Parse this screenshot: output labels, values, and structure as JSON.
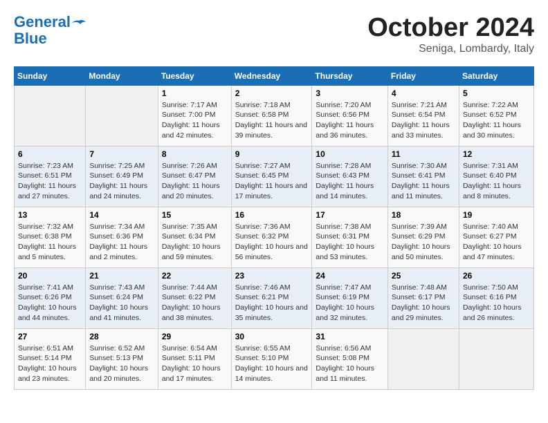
{
  "header": {
    "logo_line1": "General",
    "logo_line2": "Blue",
    "month": "October 2024",
    "location": "Seniga, Lombardy, Italy"
  },
  "days_of_week": [
    "Sunday",
    "Monday",
    "Tuesday",
    "Wednesday",
    "Thursday",
    "Friday",
    "Saturday"
  ],
  "weeks": [
    [
      {
        "day": "",
        "info": ""
      },
      {
        "day": "",
        "info": ""
      },
      {
        "day": "1",
        "info": "Sunrise: 7:17 AM\nSunset: 7:00 PM\nDaylight: 11 hours and 42 minutes."
      },
      {
        "day": "2",
        "info": "Sunrise: 7:18 AM\nSunset: 6:58 PM\nDaylight: 11 hours and 39 minutes."
      },
      {
        "day": "3",
        "info": "Sunrise: 7:20 AM\nSunset: 6:56 PM\nDaylight: 11 hours and 36 minutes."
      },
      {
        "day": "4",
        "info": "Sunrise: 7:21 AM\nSunset: 6:54 PM\nDaylight: 11 hours and 33 minutes."
      },
      {
        "day": "5",
        "info": "Sunrise: 7:22 AM\nSunset: 6:52 PM\nDaylight: 11 hours and 30 minutes."
      }
    ],
    [
      {
        "day": "6",
        "info": "Sunrise: 7:23 AM\nSunset: 6:51 PM\nDaylight: 11 hours and 27 minutes."
      },
      {
        "day": "7",
        "info": "Sunrise: 7:25 AM\nSunset: 6:49 PM\nDaylight: 11 hours and 24 minutes."
      },
      {
        "day": "8",
        "info": "Sunrise: 7:26 AM\nSunset: 6:47 PM\nDaylight: 11 hours and 20 minutes."
      },
      {
        "day": "9",
        "info": "Sunrise: 7:27 AM\nSunset: 6:45 PM\nDaylight: 11 hours and 17 minutes."
      },
      {
        "day": "10",
        "info": "Sunrise: 7:28 AM\nSunset: 6:43 PM\nDaylight: 11 hours and 14 minutes."
      },
      {
        "day": "11",
        "info": "Sunrise: 7:30 AM\nSunset: 6:41 PM\nDaylight: 11 hours and 11 minutes."
      },
      {
        "day": "12",
        "info": "Sunrise: 7:31 AM\nSunset: 6:40 PM\nDaylight: 11 hours and 8 minutes."
      }
    ],
    [
      {
        "day": "13",
        "info": "Sunrise: 7:32 AM\nSunset: 6:38 PM\nDaylight: 11 hours and 5 minutes."
      },
      {
        "day": "14",
        "info": "Sunrise: 7:34 AM\nSunset: 6:36 PM\nDaylight: 11 hours and 2 minutes."
      },
      {
        "day": "15",
        "info": "Sunrise: 7:35 AM\nSunset: 6:34 PM\nDaylight: 10 hours and 59 minutes."
      },
      {
        "day": "16",
        "info": "Sunrise: 7:36 AM\nSunset: 6:32 PM\nDaylight: 10 hours and 56 minutes."
      },
      {
        "day": "17",
        "info": "Sunrise: 7:38 AM\nSunset: 6:31 PM\nDaylight: 10 hours and 53 minutes."
      },
      {
        "day": "18",
        "info": "Sunrise: 7:39 AM\nSunset: 6:29 PM\nDaylight: 10 hours and 50 minutes."
      },
      {
        "day": "19",
        "info": "Sunrise: 7:40 AM\nSunset: 6:27 PM\nDaylight: 10 hours and 47 minutes."
      }
    ],
    [
      {
        "day": "20",
        "info": "Sunrise: 7:41 AM\nSunset: 6:26 PM\nDaylight: 10 hours and 44 minutes."
      },
      {
        "day": "21",
        "info": "Sunrise: 7:43 AM\nSunset: 6:24 PM\nDaylight: 10 hours and 41 minutes."
      },
      {
        "day": "22",
        "info": "Sunrise: 7:44 AM\nSunset: 6:22 PM\nDaylight: 10 hours and 38 minutes."
      },
      {
        "day": "23",
        "info": "Sunrise: 7:46 AM\nSunset: 6:21 PM\nDaylight: 10 hours and 35 minutes."
      },
      {
        "day": "24",
        "info": "Sunrise: 7:47 AM\nSunset: 6:19 PM\nDaylight: 10 hours and 32 minutes."
      },
      {
        "day": "25",
        "info": "Sunrise: 7:48 AM\nSunset: 6:17 PM\nDaylight: 10 hours and 29 minutes."
      },
      {
        "day": "26",
        "info": "Sunrise: 7:50 AM\nSunset: 6:16 PM\nDaylight: 10 hours and 26 minutes."
      }
    ],
    [
      {
        "day": "27",
        "info": "Sunrise: 6:51 AM\nSunset: 5:14 PM\nDaylight: 10 hours and 23 minutes."
      },
      {
        "day": "28",
        "info": "Sunrise: 6:52 AM\nSunset: 5:13 PM\nDaylight: 10 hours and 20 minutes."
      },
      {
        "day": "29",
        "info": "Sunrise: 6:54 AM\nSunset: 5:11 PM\nDaylight: 10 hours and 17 minutes."
      },
      {
        "day": "30",
        "info": "Sunrise: 6:55 AM\nSunset: 5:10 PM\nDaylight: 10 hours and 14 minutes."
      },
      {
        "day": "31",
        "info": "Sunrise: 6:56 AM\nSunset: 5:08 PM\nDaylight: 10 hours and 11 minutes."
      },
      {
        "day": "",
        "info": ""
      },
      {
        "day": "",
        "info": ""
      }
    ]
  ]
}
